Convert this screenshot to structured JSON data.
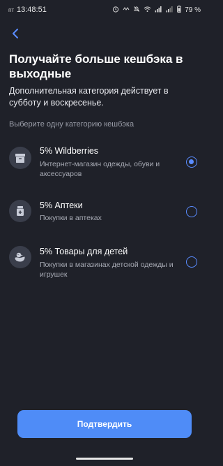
{
  "status": {
    "day": "пт",
    "time": "13:48:51",
    "battery": "79 %"
  },
  "header": {
    "title": "Получайте больше кешбэка в выходные",
    "subtitle": "Дополнительная категория действует в субботу и воскресенье."
  },
  "section_label": "Выберите одну категорию кешбэка",
  "options": [
    {
      "title": "5% Wildberries",
      "description": "Интернет-магазин одежды, обуви и аксессуаров",
      "selected": true,
      "icon": "box-icon"
    },
    {
      "title": "5% Аптеки",
      "description": "Покупки в аптеках",
      "selected": false,
      "icon": "pill-bottle-icon"
    },
    {
      "title": "5% Товары для детей",
      "description": "Покупки в магазинах детской одежды и игрушек",
      "selected": false,
      "icon": "duck-icon"
    }
  ],
  "confirm_label": "Подтвердить",
  "colors": {
    "background": "#1f2129",
    "accent": "#4f8cf7",
    "icon_bg": "#3a3e4b"
  }
}
